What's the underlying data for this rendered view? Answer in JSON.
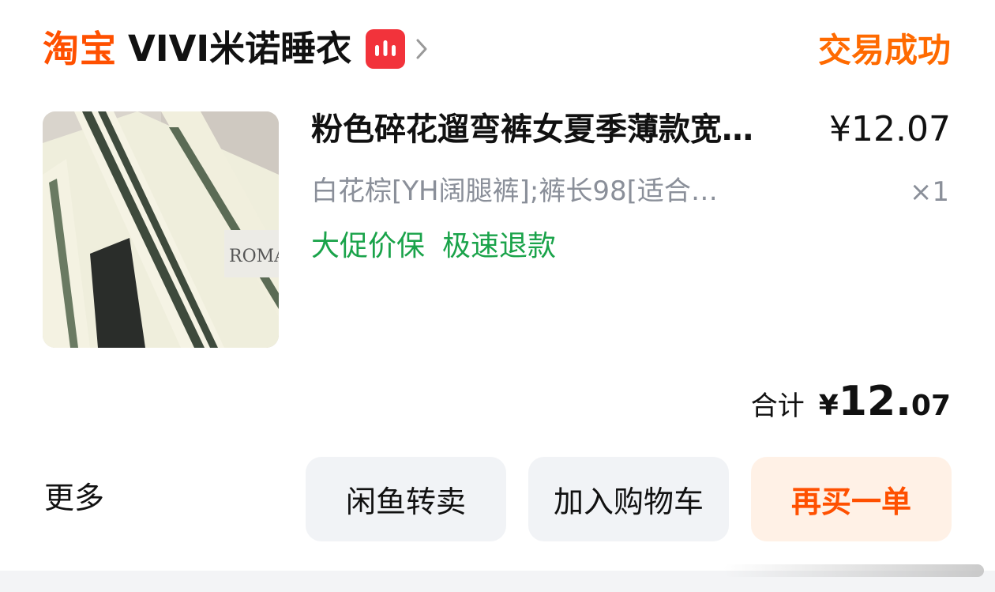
{
  "order": {
    "platform": "淘宝",
    "shop_name": "VIVI米诺睡衣",
    "status": "交易成功",
    "icons": {
      "live": "live-stream-icon",
      "chevron": "chevron-right-icon"
    }
  },
  "product": {
    "title": "粉色碎花遛弯裤女夏季薄款宽…",
    "price": "¥12.07",
    "spec": "白花棕[YH阔腿裤];裤长98[适合…",
    "quantity": "×1",
    "tags": [
      "大促价保",
      "极速退款"
    ],
    "image_text": "ROMA"
  },
  "total": {
    "label": "合计",
    "currency": "¥",
    "integer": "12.",
    "decimal": "07"
  },
  "actions": {
    "more": "更多",
    "xianyu": "闲鱼转卖",
    "add_cart": "加入购物车",
    "rebuy": "再买一单"
  },
  "colors": {
    "brand": "#ff5000",
    "status": "#ff6a00",
    "tag_green": "#1aa34a",
    "muted": "#8a8f99",
    "live_red": "#f2333b"
  }
}
